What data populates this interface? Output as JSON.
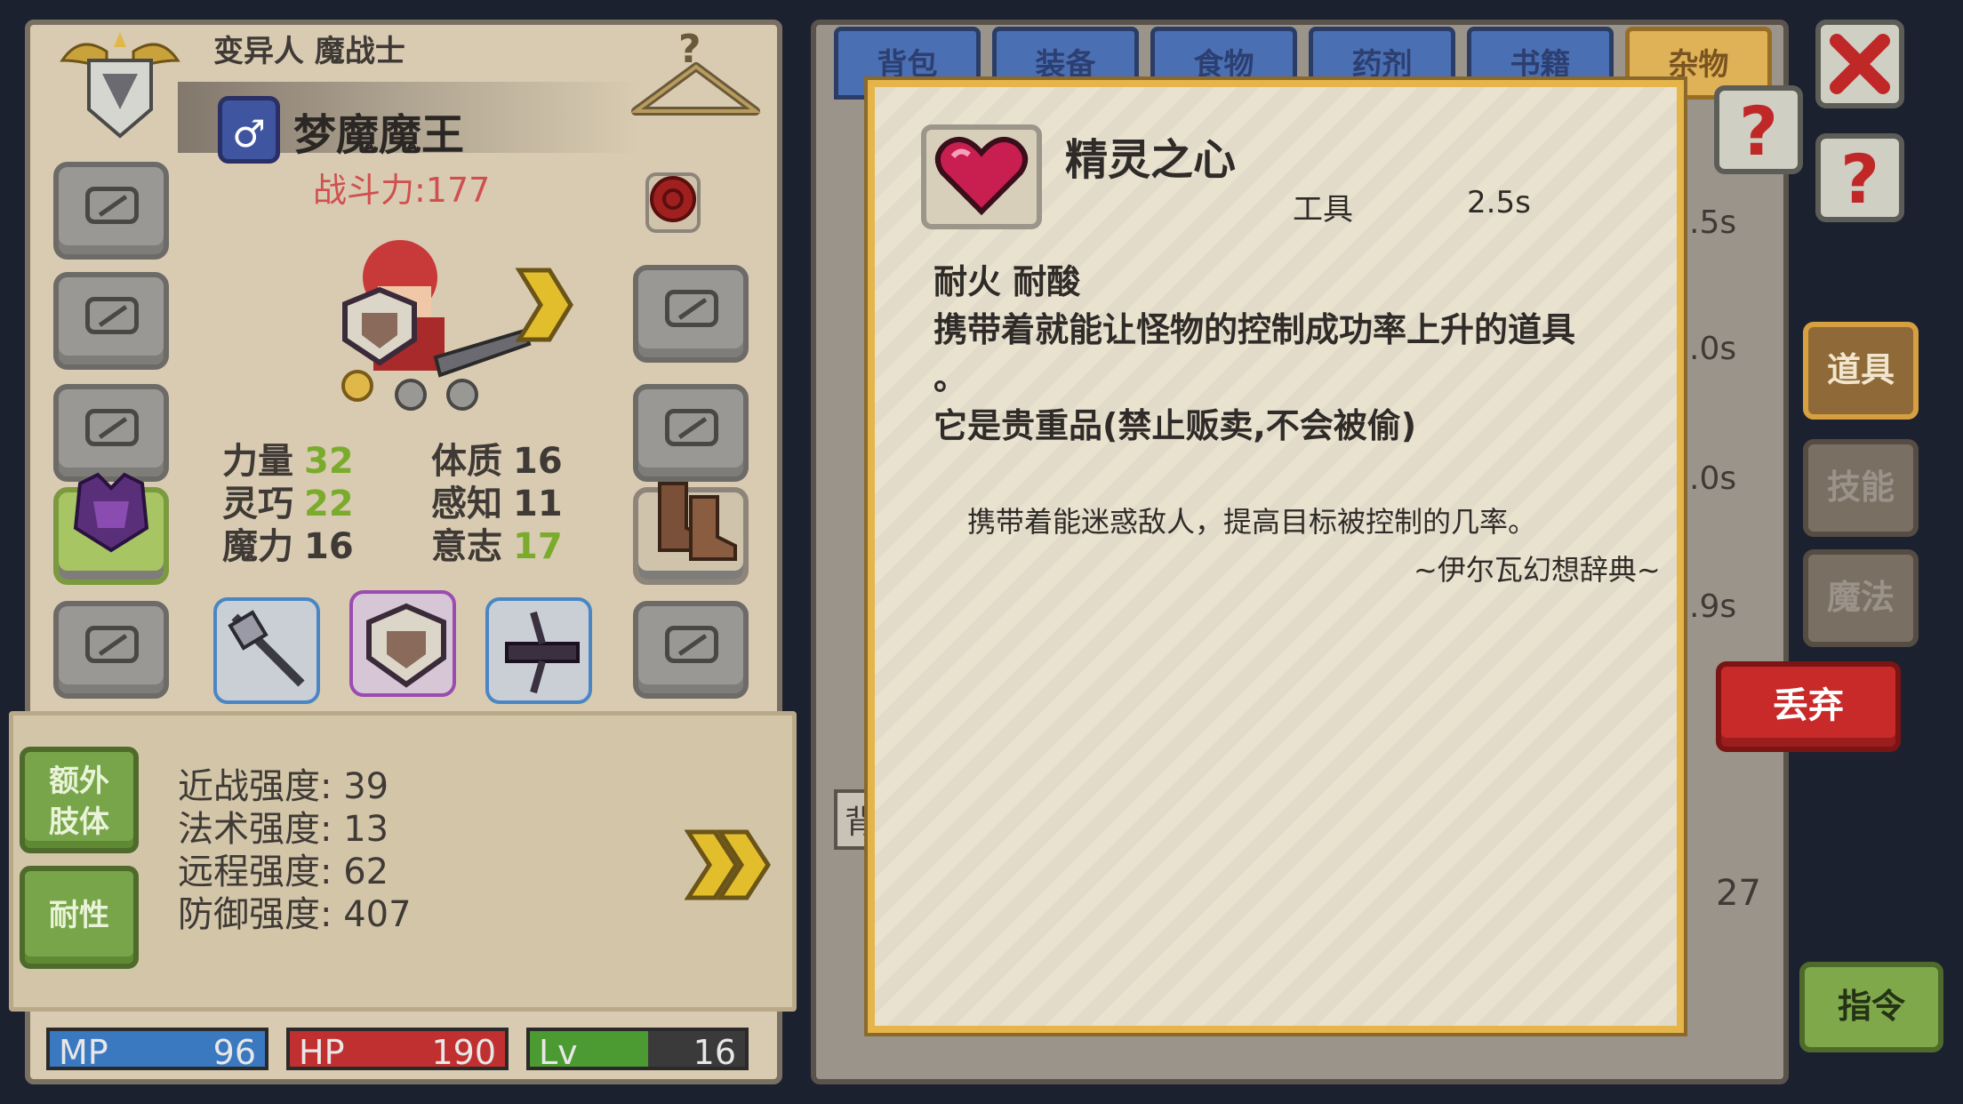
{
  "character": {
    "class_label": "变异人 魔战士",
    "gender_symbol": "♂",
    "name": "梦魔魔王",
    "combat_power": "战斗力:177"
  },
  "stats": [
    {
      "label": "力量",
      "value": "32",
      "green": true
    },
    {
      "label": "体质",
      "value": "16",
      "green": false
    },
    {
      "label": "灵巧",
      "value": "22",
      "green": true
    },
    {
      "label": "感知",
      "value": "11",
      "green": false
    },
    {
      "label": "魔力",
      "value": "16",
      "green": false
    },
    {
      "label": "意志",
      "value": "17",
      "green": true
    }
  ],
  "attributes": {
    "extra_limb_label": "额外\n肢体",
    "resistance_label": "耐性",
    "melee": "近战强度: 39",
    "magic": "法术强度: 13",
    "ranged": "远程强度: 62",
    "defense": "防御强度: 407"
  },
  "resources": {
    "mp_label": "MP",
    "mp_value": "96",
    "hp_label": "HP",
    "hp_value": "190",
    "lv_label": "Lv",
    "lv_value": "16",
    "mp_fill": 1.0,
    "hp_fill": 1.0,
    "lv_fill": 0.55
  },
  "inventory": {
    "tabs": [
      "背包",
      "装备",
      "食物",
      "药剂",
      "书籍",
      "杂物"
    ],
    "active_tab": "杂物",
    "side_tabs": [
      "道具",
      "技能",
      "魔法"
    ],
    "side_active": "道具",
    "strip_values": [
      ".5s",
      ".0s",
      ".0s",
      ".9s"
    ],
    "bag_label": "背",
    "count": "27",
    "discard_label": "丢弃",
    "command_label": "指令"
  },
  "item": {
    "name": "精灵之心",
    "category": "工具",
    "time": "2.5s",
    "properties": "耐火  耐酸",
    "description_line1": "携带着就能让怪物的控制成功率上升的道具",
    "description_line2": "。",
    "note": "它是贵重品(禁止贩卖,不会被偷)",
    "flavor": "携带着能迷惑敌人，提高目标被控制的几率。",
    "flavor_source": "~伊尔瓦幻想辞典~"
  },
  "colors": {
    "accent_gold": "#e5b54a",
    "discard_red": "#c82a2a",
    "stat_green": "#7bab2c",
    "combat_red": "#d05050",
    "mp_blue": "#3a78c0",
    "hp_red": "#c03030",
    "lv_green": "#4c9a32"
  }
}
